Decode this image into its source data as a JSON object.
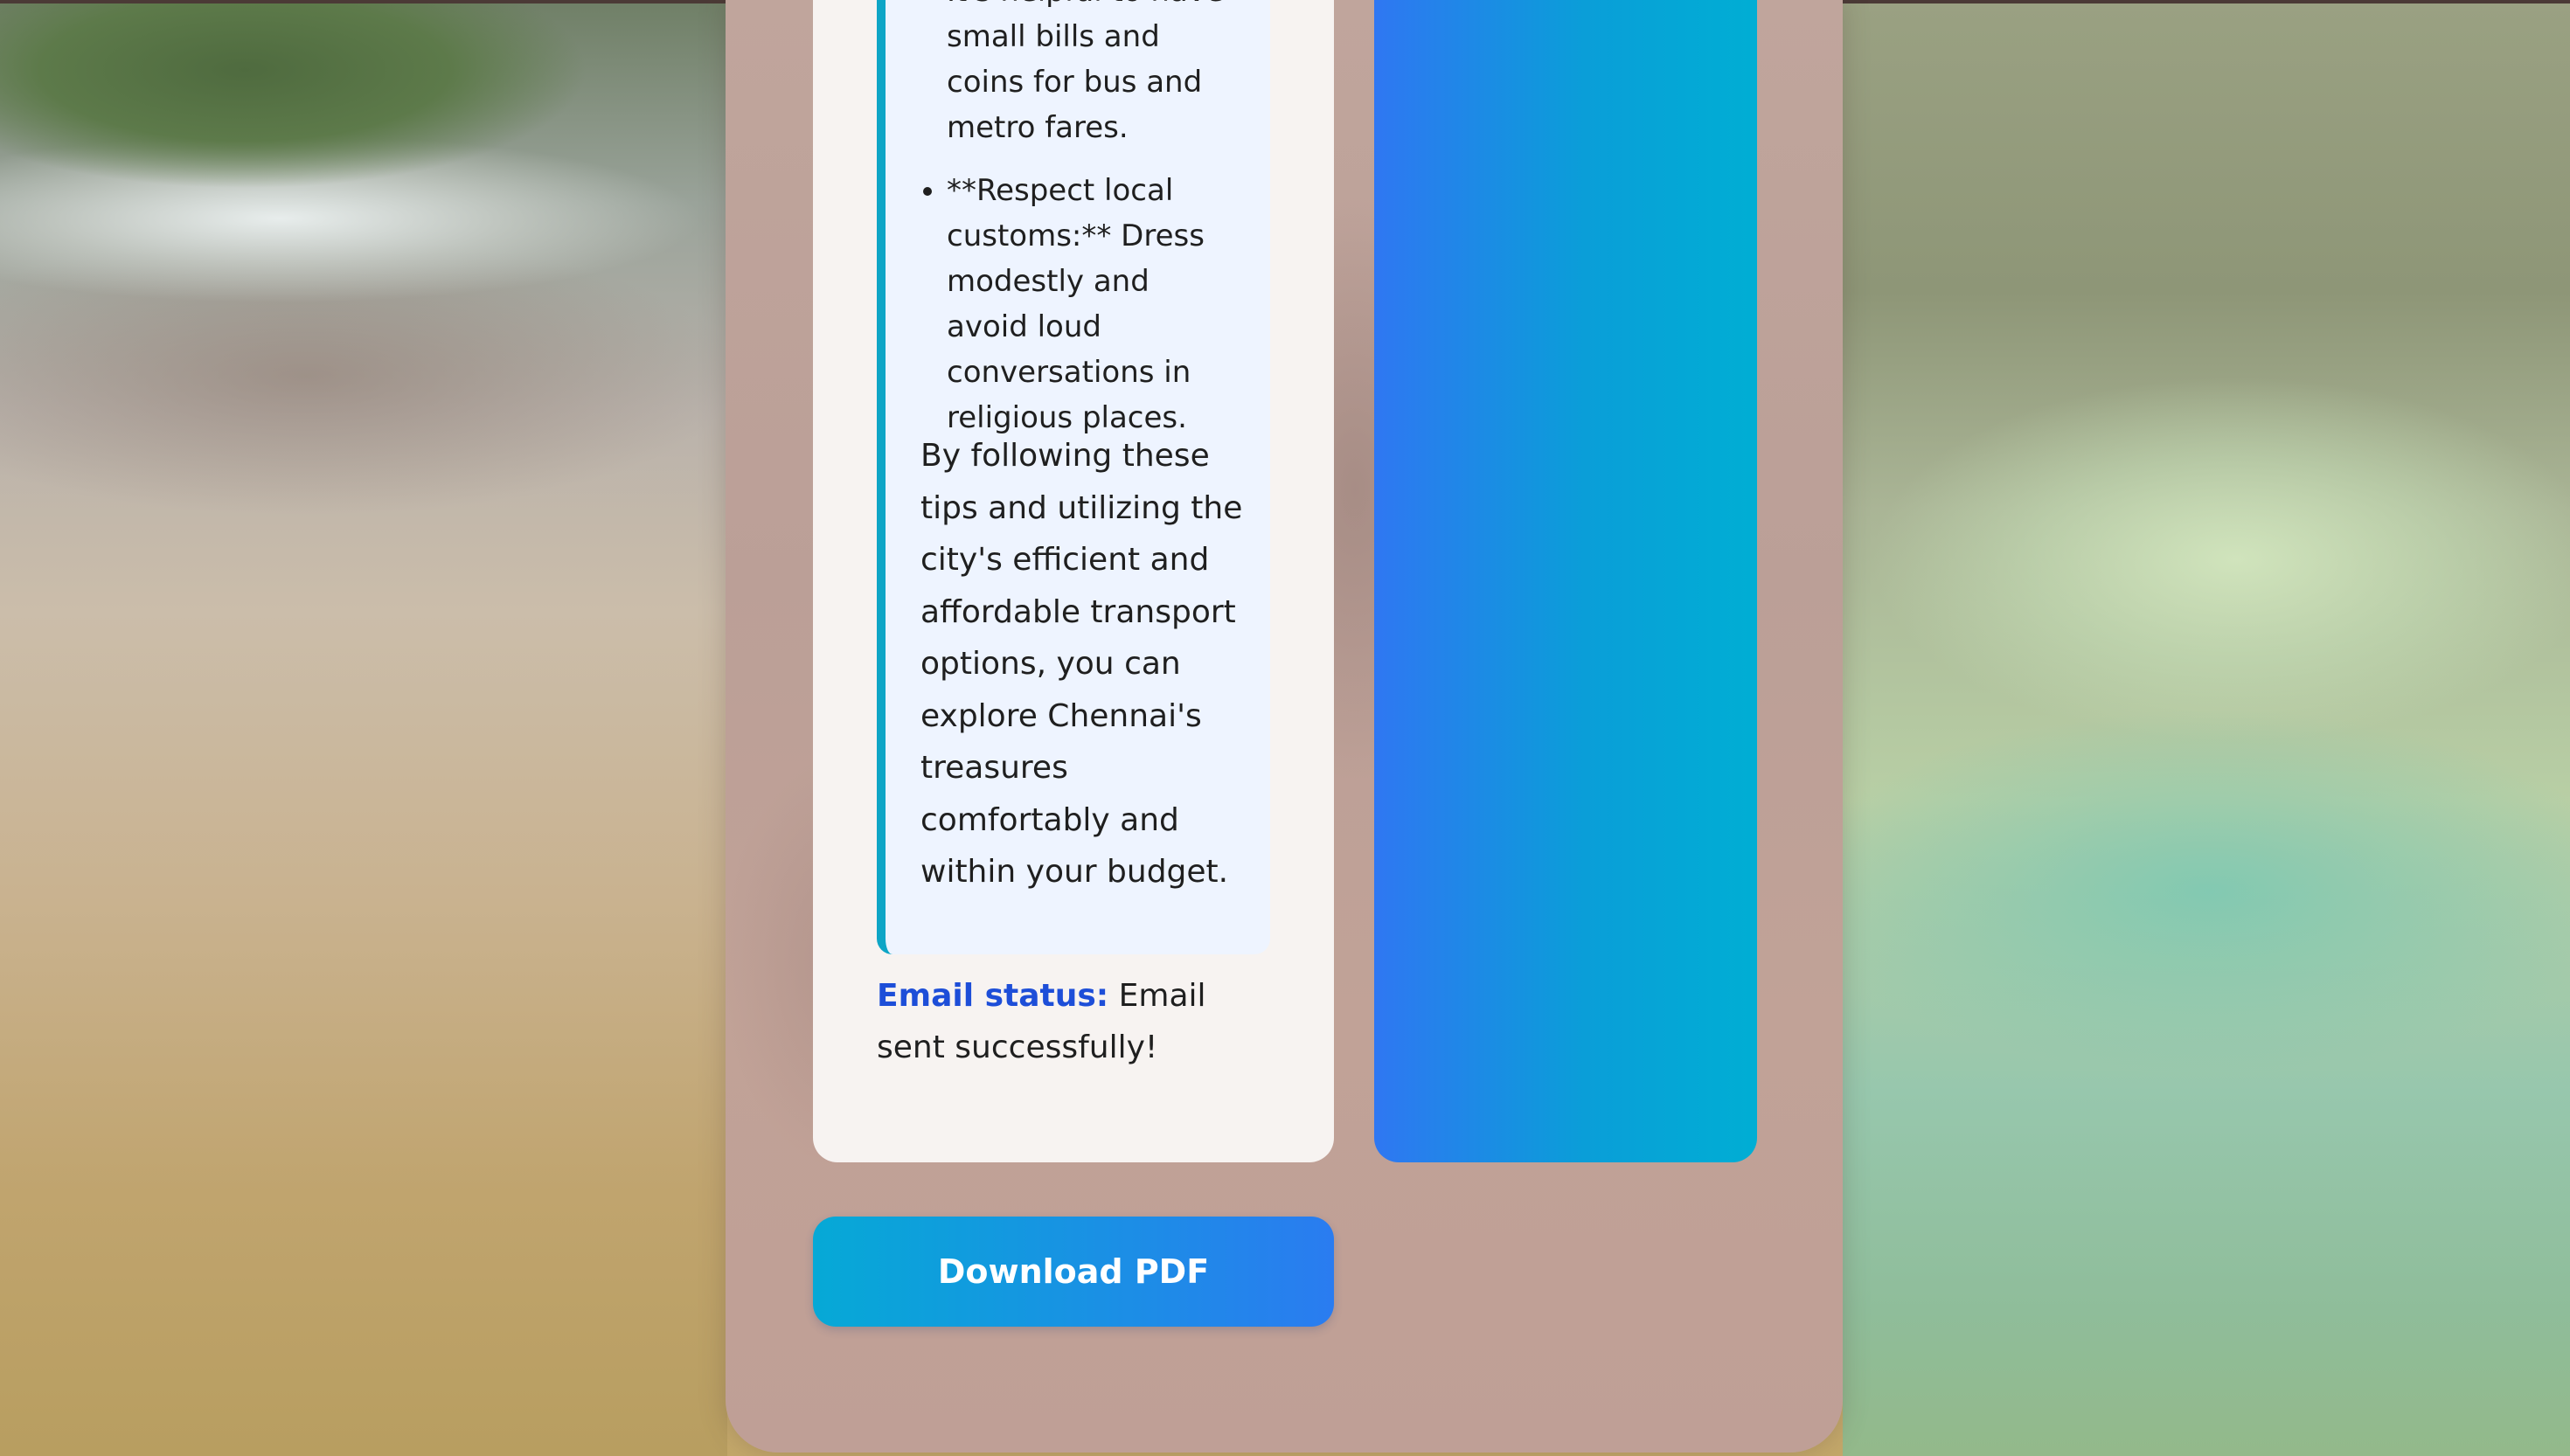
{
  "tips": {
    "items": [
      {
        "text": "It's helpful to have small bills and coins for bus and metro fares."
      },
      {
        "text": "**Respect local customs:** Dress modestly and avoid loud conversations in religious places."
      }
    ],
    "summary": "By following these tips and utilizing the city's efficient and affordable transport options, you can explore Chennai's treasures comfortably and within your budget."
  },
  "email": {
    "label": "Email status:",
    "value": "Email sent successfully!"
  },
  "actions": {
    "download_label": "Download PDF"
  }
}
